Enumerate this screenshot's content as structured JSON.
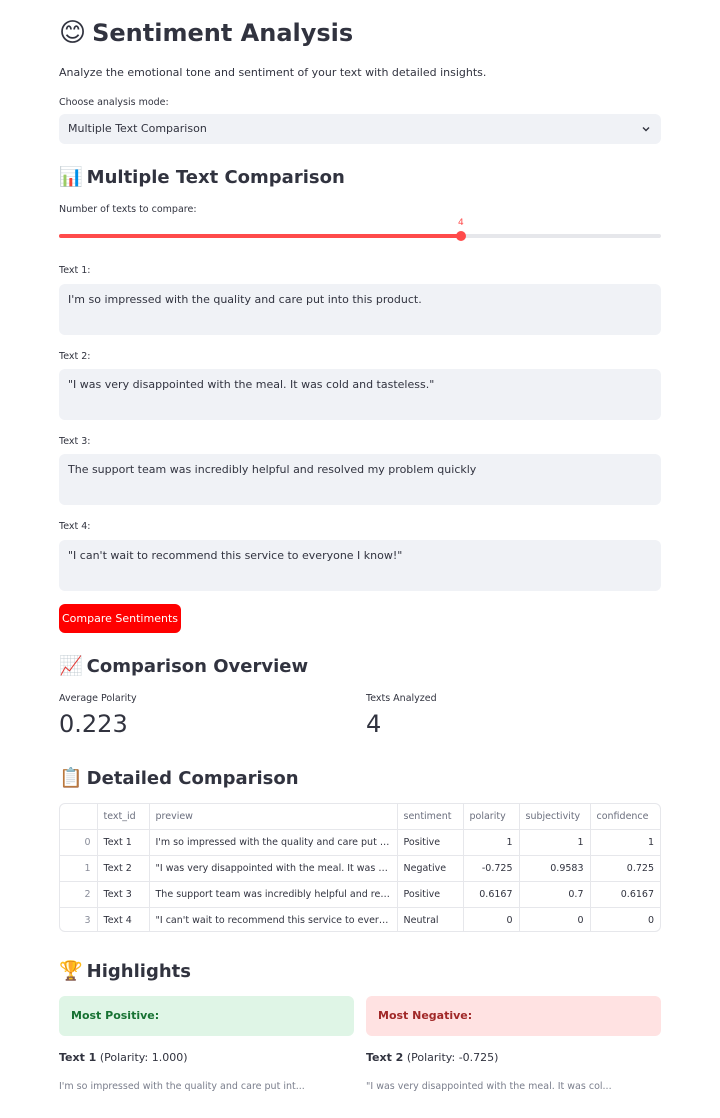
{
  "header": {
    "emoji": "😊",
    "title": "Sentiment Analysis",
    "caption": "Analyze the emotional tone and sentiment of your text with detailed insights."
  },
  "mode": {
    "label": "Choose analysis mode:",
    "selected": "Multiple Text Comparison"
  },
  "comparison": {
    "emoji": "📊",
    "title": "Multiple Text Comparison",
    "slider_label": "Number of texts to compare:",
    "slider_value": "4",
    "slider_fraction": 0.667,
    "texts": [
      {
        "label": "Text 1:",
        "value": "I'm so impressed with the quality and care put into this product."
      },
      {
        "label": "Text 2:",
        "value": "\"I was very disappointed with the meal. It was cold and tasteless.\""
      },
      {
        "label": "Text 3:",
        "value": "The support team was incredibly helpful and resolved my problem quickly"
      },
      {
        "label": "Text 4:",
        "value": "\"I can't wait to recommend this service to everyone I know!\""
      }
    ],
    "button_label": "Compare Sentiments"
  },
  "overview": {
    "emoji": "📈",
    "title": "Comparison Overview",
    "metrics": [
      {
        "label": "Average Polarity",
        "value": "0.223"
      },
      {
        "label": "Texts Analyzed",
        "value": "4"
      }
    ]
  },
  "detailed": {
    "emoji": "📋",
    "title": "Detailed Comparison",
    "columns": [
      "",
      "text_id",
      "preview",
      "sentiment",
      "polarity",
      "subjectivity",
      "confidence"
    ],
    "rows": [
      [
        "0",
        "Text 1",
        "I'm so impressed with the quality and care put int...",
        "Positive",
        "1",
        "1",
        "1"
      ],
      [
        "1",
        "Text 2",
        "\"I was very disappointed with the meal. It was col...",
        "Negative",
        "-0.725",
        "0.9583",
        "0.725"
      ],
      [
        "2",
        "Text 3",
        "The support team was incredibly helpful and resolv...",
        "Positive",
        "0.6167",
        "0.7",
        "0.6167"
      ],
      [
        "3",
        "Text 4",
        "\"I can't wait to recommend this service to everyon...",
        "Neutral",
        "0",
        "0",
        "0"
      ]
    ]
  },
  "highlights": {
    "emoji": "🏆",
    "title": "Highlights",
    "positive": {
      "alert": "Most Positive:",
      "id": "Text 1",
      "detail": "(Polarity: 1.000)",
      "preview": "I'm so impressed with the quality and care put int..."
    },
    "negative": {
      "alert": "Most Negative:",
      "id": "Text 2",
      "detail": "(Polarity: -0.725)",
      "preview": "\"I was very disappointed with the meal. It was col..."
    }
  },
  "colors": {
    "accent": "#ff4b4b",
    "button": "#ff0000",
    "input_bg": "#f0f2f6",
    "success_bg": "#dff5e6",
    "error_bg": "#ffe2e2"
  }
}
